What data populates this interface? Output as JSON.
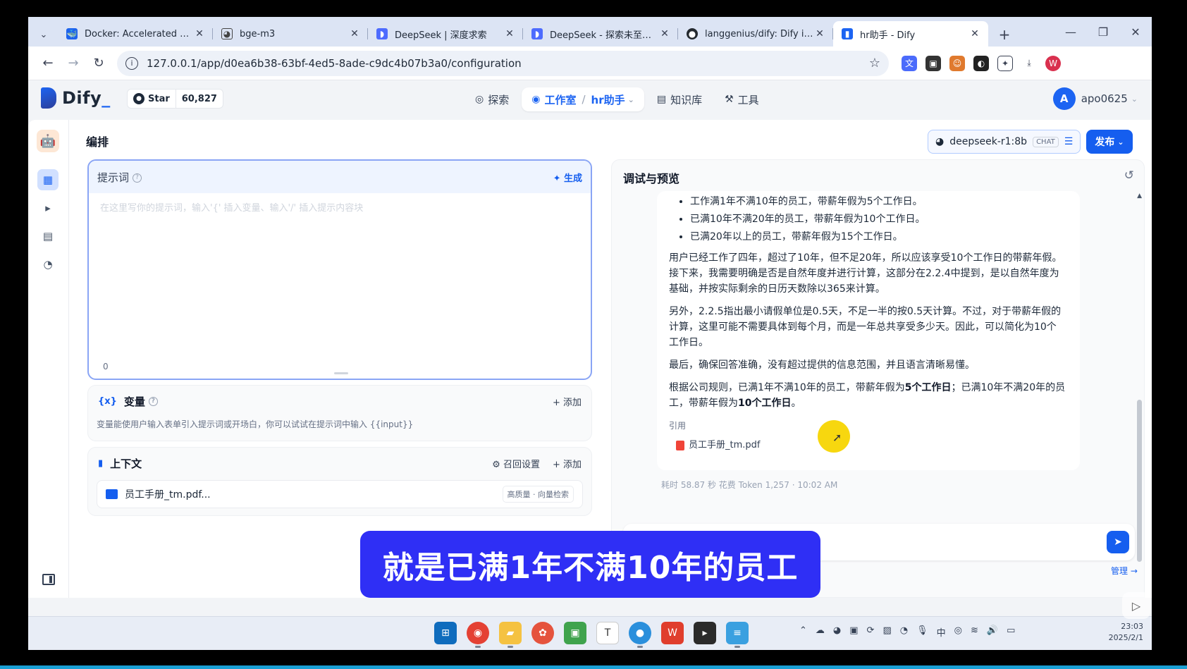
{
  "browser": {
    "tabs": [
      {
        "title": "Docker: Accelerated Con",
        "icon": "docker-icon",
        "color": "#1d63ed"
      },
      {
        "title": "bge-m3",
        "icon": "ollama-icon",
        "color": "#444444"
      },
      {
        "title": "DeepSeek | 深度求索",
        "icon": "deepseek-icon",
        "color": "#4d6bfe"
      },
      {
        "title": "DeepSeek - 探索未至之境",
        "icon": "deepseek-icon",
        "color": "#4d6bfe"
      },
      {
        "title": "langgenius/dify: Dify is a",
        "icon": "github-icon",
        "color": "#24292f"
      },
      {
        "title": "hr助手 - Dify",
        "icon": "dify-icon",
        "color": "#1c64f2"
      }
    ],
    "url": "127.0.0.1/app/d0ea6b38-63bf-4ed5-8ade-c9dc4b07b3a0/configuration"
  },
  "header": {
    "logo": "Dify",
    "github_star_label": "Star",
    "github_star_count": "60,827",
    "nav": {
      "explore": "探索",
      "studio": "工作室",
      "app_name": "hr助手",
      "knowledge": "知识库",
      "tools": "工具"
    },
    "avatar_letter": "A",
    "username": "apo0625"
  },
  "orchestrate": {
    "title": "编排",
    "model_name": "deepseek-r1:8b",
    "model_chip": "CHAT",
    "publish_label": "发布"
  },
  "prompt": {
    "label": "提示词",
    "generate_label": "生成",
    "placeholder": "在这里写你的提示词，输入'{' 插入变量、输入'/' 插入提示内容块",
    "char_count": "0"
  },
  "variables": {
    "title": "变量",
    "add_label": "添加",
    "description": "变量能使用户输入表单引入提示词或开场白，你可以试试在提示词中输入 {{input}}"
  },
  "context": {
    "title": "上下文",
    "recall_label": "召回设置",
    "add_label": "添加",
    "file_name": "员工手册_tm.pdf...",
    "file_badge": "高质量 · 向量检索"
  },
  "debug": {
    "title": "调试与预览",
    "bullets": [
      "工作满1年不满10年的员工，带薪年假为5个工作日。",
      "已满10年不满20年的员工，带薪年假为10个工作日。",
      "已满20年以上的员工，带薪年假为15个工作日。"
    ],
    "para1": "用户已经工作了四年，超过了10年，但不足20年，所以应该享受10个工作日的带薪年假。接下来，我需要明确是否是自然年度并进行计算，这部分在2.2.4中提到，是以自然年度为基础，并按实际剩余的日历天数除以365来计算。",
    "para2": "另外，2.2.5指出最小请假单位是0.5天，不足一半的按0.5天计算。不过，对于带薪年假的计算，这里可能不需要具体到每个月，而是一年总共享受多少天。因此，可以简化为10个工作日。",
    "para3": "最后，确保回答准确，没有超过提供的信息范围，并且语言清晰易懂。",
    "final_a": "根据公司规则，已满1年不满10年的员工，带薪年假为",
    "final_b": "5个工作日",
    "final_c": "；已满10年不满20年的员工，带薪年假为",
    "final_d": "10个工作日",
    "final_e": "。",
    "citation_label": "引用",
    "citation_file": "员工手册_tm.pdf",
    "meta": "耗时 58.87 秒  花费 Token 1,257 · 10:02 AM",
    "manage_label": "管理 →"
  },
  "subtitle": "就是已满1年不满10年的员工",
  "taskbar": {
    "time": "23:03",
    "date": "2025/2/1",
    "ime": "中"
  },
  "colors": {
    "accent": "#155eef",
    "subtitle_bg": "#2f2ff5",
    "cursor_highlight": "#f7d70f"
  }
}
